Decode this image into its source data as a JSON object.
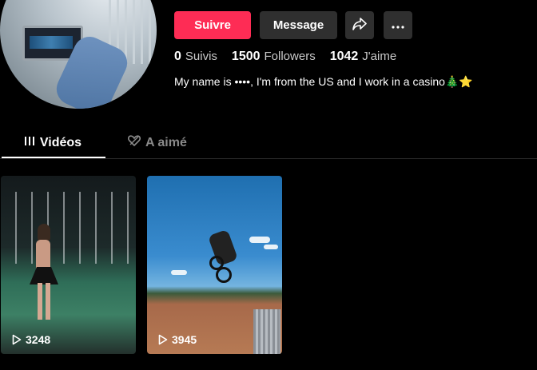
{
  "profile": {
    "follow_label": "Suivre",
    "message_label": "Message",
    "share_icon": "share-icon",
    "more_icon": "more-icon",
    "stats": [
      {
        "value": "0",
        "label": "Suivis"
      },
      {
        "value": "1500",
        "label": "Followers"
      },
      {
        "value": "1042",
        "label": "J'aime"
      }
    ],
    "bio": "My name is ••••, I'm from the US and I work in a casino🎄⭐"
  },
  "tabs": [
    {
      "label": "Vidéos",
      "icon": "bars-icon",
      "active": true
    },
    {
      "label": "A aimé",
      "icon": "heart-outline-icon",
      "active": false
    }
  ],
  "videos": [
    {
      "views": "3248"
    },
    {
      "views": "3945"
    }
  ],
  "colors": {
    "accent": "#fe2c55",
    "button_dark": "#2f2f2f",
    "background": "#000000"
  }
}
